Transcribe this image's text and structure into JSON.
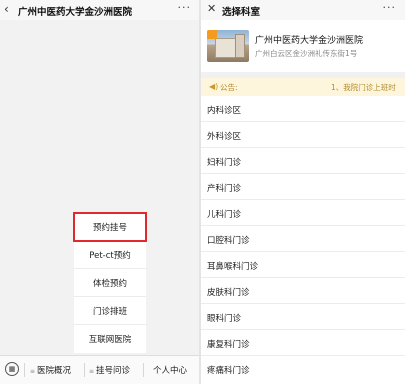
{
  "left": {
    "nav": {
      "back_icon": "‹",
      "title": "广州中医药大学金沙洲医院",
      "more_icon": "···"
    },
    "menu": {
      "items": [
        {
          "label": "预约挂号",
          "highlighted": true
        },
        {
          "label": "Pet-ct预约"
        },
        {
          "label": "体检预约"
        },
        {
          "label": "门诊排班"
        },
        {
          "label": "互联网医院"
        }
      ]
    },
    "tabbar": {
      "keyboard_icon": "keyboard-icon",
      "tabs": [
        {
          "label": "医院概况"
        },
        {
          "label": "挂号问诊"
        },
        {
          "label": "个人中心"
        }
      ]
    }
  },
  "right": {
    "nav": {
      "close_icon": "✕",
      "title": "选择科室",
      "more_icon": "···"
    },
    "hospital": {
      "name": "广州中医药大学金沙洲医院",
      "address": "广州白云区金沙洲礼传东街1号"
    },
    "notice": {
      "label": "公告:",
      "text": "1、我院门诊上班时"
    },
    "departments": [
      "内科诊区",
      "外科诊区",
      "妇科门诊",
      "产科门诊",
      "儿科门诊",
      "口腔科门诊",
      "耳鼻喉科门诊",
      "皮肤科门诊",
      "眼科门诊",
      "康复科门诊",
      "疼痛科门诊"
    ]
  },
  "colors": {
    "highlight": "#e0282e",
    "notice_bg": "#fdf5dc",
    "notice_text": "#b38b2b"
  }
}
